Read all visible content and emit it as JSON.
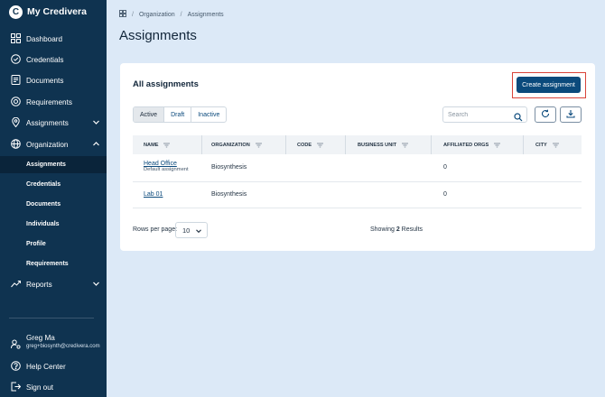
{
  "brand": {
    "logo_letter": "C",
    "name": "My Credivera"
  },
  "nav": {
    "dashboard": "Dashboard",
    "credentials": "Credentials",
    "documents": "Documents",
    "requirements": "Requirements",
    "assignments": "Assignments",
    "organization": "Organization",
    "reports": "Reports",
    "help": "Help Center",
    "signout": "Sign out"
  },
  "org_sub": [
    "Assignments",
    "Credentials",
    "Documents",
    "Individuals",
    "Profile",
    "Requirements"
  ],
  "user": {
    "name": "Greg Ma",
    "email": "greg+biosynth@credivera.com"
  },
  "breadcrumb": [
    "Organization",
    "Assignments"
  ],
  "page_title": "Assignments",
  "card": {
    "title": "All assignments",
    "create_label": "Create assignment",
    "filters": [
      "Active",
      "Draft",
      "Inactive"
    ],
    "active_filter": "Active",
    "search_placeholder": "Search"
  },
  "table": {
    "columns": [
      "NAME",
      "ORGANIZATION",
      "CODE",
      "BUSINESS UNIT",
      "AFFILIATED ORGS",
      "CITY"
    ],
    "rows": [
      {
        "name": "Head Office",
        "subtext": "Default assignment",
        "organization": "Biosynthesis",
        "code": "",
        "business_unit": "",
        "affiliated_orgs": "0",
        "city": ""
      },
      {
        "name": "Lab 01",
        "subtext": "",
        "organization": "Biosynthesis",
        "code": "",
        "business_unit": "",
        "affiliated_orgs": "0",
        "city": ""
      }
    ]
  },
  "pagination": {
    "rows_per_page_label": "Rows per page:",
    "rows_per_page_value": "10",
    "showing_prefix": "Showing",
    "showing_count": "2",
    "showing_suffix": "Results"
  },
  "colors": {
    "sidebar": "#0f3350",
    "accent": "#0b4a7c",
    "highlight_border": "#d9443a",
    "page_bg": "#dce9f7"
  }
}
